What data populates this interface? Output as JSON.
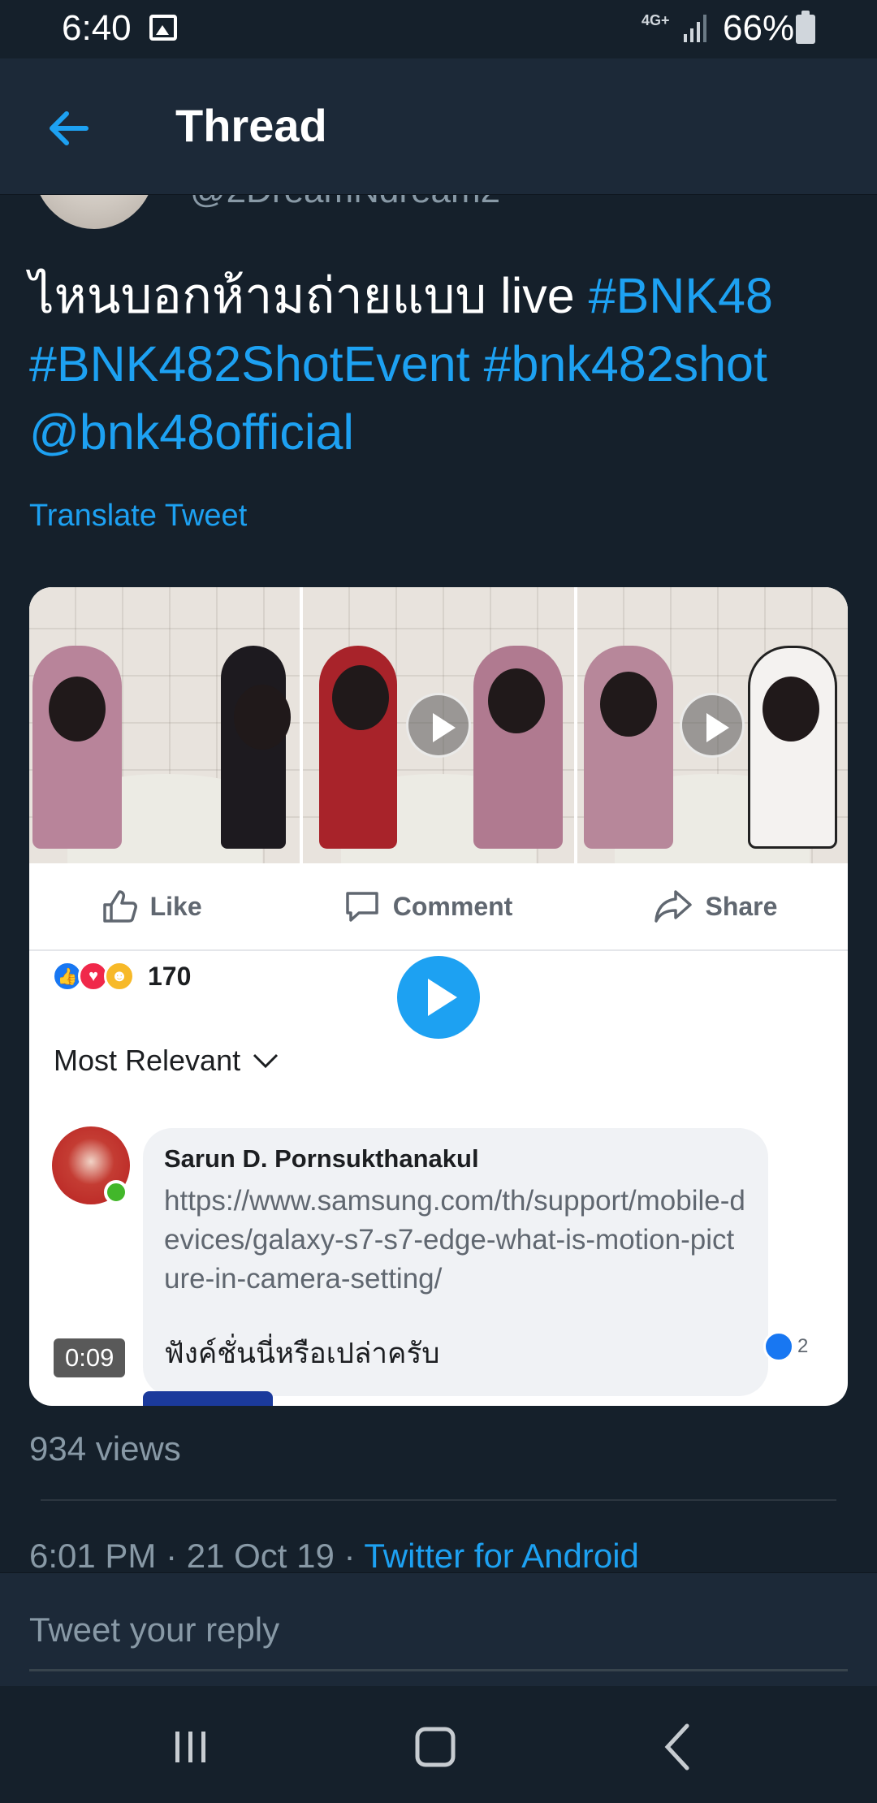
{
  "status_bar": {
    "time": "6:40",
    "network": "4G+",
    "battery": "66%",
    "battery_level": 0.66
  },
  "header": {
    "title": "Thread",
    "back_icon": "arrow-left-icon"
  },
  "tweet": {
    "handle_partial": "@2DreamNdream2",
    "text_plain": "ไหนบอกห้ามถ่ายแบบ live ",
    "hashtag_1": "#BNK48",
    "hashtag_2": "#BNK482ShotEvent",
    "hashtag_3": "#bnk482shot",
    "mention": "@bnk48official",
    "translate": "Translate Tweet",
    "views": "934 views",
    "time_date": "6:01 PM · 21 Oct 19 · ",
    "source": "Twitter for Android"
  },
  "media": {
    "duration": "0:09",
    "fb_actions": {
      "like": "Like",
      "comment": "Comment",
      "share": "Share"
    },
    "reaction_count": "170",
    "sort_label": "Most Relevant",
    "comment": {
      "author": "Sarun D. Pornsukthanakul",
      "url": "https://www.samsung.com/th/support/mobile-devices/galaxy-s7-s7-edge-what-is-motion-picture-in-camera-setting/",
      "body": "ฟังค์ชั่นนี่หรือเปล่าครับ",
      "likes": "2"
    }
  },
  "reply": {
    "placeholder": "Tweet your reply"
  },
  "colors": {
    "background": "#15202b",
    "header": "#1c2938",
    "accent": "#1da1f2",
    "muted": "#8899a6"
  }
}
